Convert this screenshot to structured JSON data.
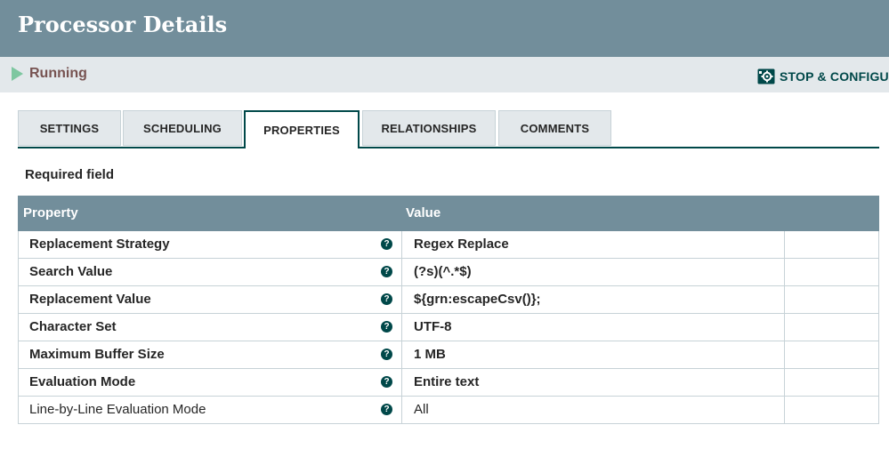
{
  "window": {
    "title": "Processor Details"
  },
  "status": {
    "label": "Running",
    "icon": "play-icon",
    "color": "#7dc7a0"
  },
  "actions": {
    "stop_configure_label": "STOP & CONFIGURE",
    "icon": "gear-stop-icon"
  },
  "tabs": [
    {
      "label": "SETTINGS",
      "active": false
    },
    {
      "label": "SCHEDULING",
      "active": false
    },
    {
      "label": "PROPERTIES",
      "active": true
    },
    {
      "label": "RELATIONSHIPS",
      "active": false
    },
    {
      "label": "COMMENTS",
      "active": false
    }
  ],
  "required_label": "Required field",
  "table": {
    "headers": {
      "property": "Property",
      "value": "Value"
    },
    "rows": [
      {
        "property": "Replacement Strategy",
        "value": "Regex Replace",
        "required": true
      },
      {
        "property": "Search Value",
        "value": "(?s)(^.*$)",
        "required": true
      },
      {
        "property": "Replacement Value",
        "value": "${grn:escapeCsv()};",
        "required": true
      },
      {
        "property": "Character Set",
        "value": "UTF-8",
        "required": true
      },
      {
        "property": "Maximum Buffer Size",
        "value": "1 MB",
        "required": true
      },
      {
        "property": "Evaluation Mode",
        "value": "Entire text",
        "required": true
      },
      {
        "property": "Line-by-Line Evaluation Mode",
        "value": "All",
        "required": false
      }
    ]
  },
  "colors": {
    "header_bg": "#728e9b",
    "status_bg": "#e3e8eb",
    "accent": "#004849",
    "status_text": "#775351"
  }
}
